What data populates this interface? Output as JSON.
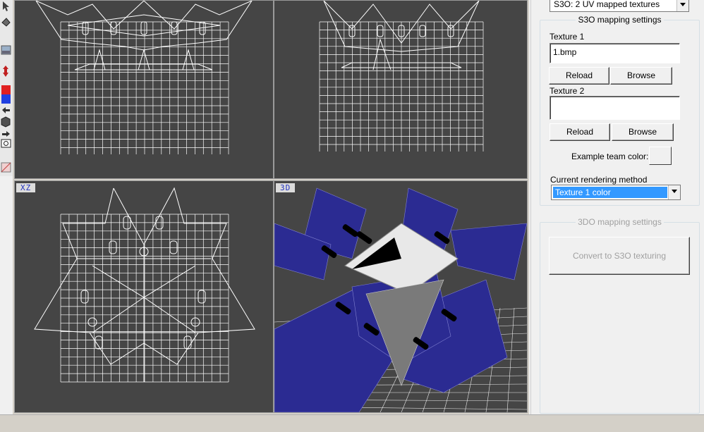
{
  "viewports": {
    "top_left": {
      "label": ""
    },
    "top_right": {
      "label": ""
    },
    "bottom_left": {
      "label": "XZ"
    },
    "bottom_right": {
      "label": "3D"
    }
  },
  "toolbar": {
    "icons": [
      "select-icon",
      "rotate-icon",
      "image-icon",
      "move-icon",
      "color-icon",
      "undo-icon",
      "cube-icon",
      "redo-icon",
      "camera-icon",
      "texture-icon"
    ]
  },
  "panel": {
    "texture_mode": "S3O: 2 UV mapped textures",
    "s3o_group_title": "S3O mapping settings",
    "texture1_label": "Texture 1",
    "texture1_value": "1.bmp",
    "reload1_label": "Reload",
    "browse1_label": "Browse",
    "texture2_label": "Texture 2",
    "texture2_value": "",
    "reload2_label": "Reload",
    "browse2_label": "Browse",
    "team_color_label": "Example team color:",
    "rendering_method_label": "Current rendering method",
    "rendering_method_value": "Texture 1 color",
    "tdo_group_title": "3DO mapping settings",
    "convert_label": "Convert to S3O texturing"
  },
  "colors": {
    "viewport_bg": "#454545",
    "wire": "#ffffff",
    "texture_blue": "#2a2a8c",
    "selection": "#3399ff"
  }
}
